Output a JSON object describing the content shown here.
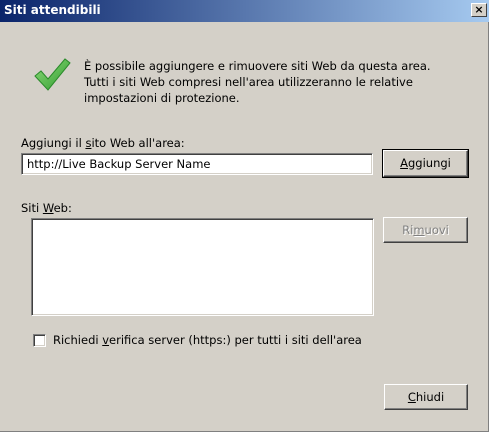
{
  "window": {
    "title": "Siti attendibili",
    "close_glyph": "×"
  },
  "intro": {
    "icon": "checkmark-icon",
    "text": "È possibile aggiungere e rimuovere siti Web da questa area.\nTutti i siti Web compresi nell'area utilizzeranno le relative\nimpostazioni di protezione."
  },
  "add_site": {
    "label_pre": "Aggiungi il ",
    "label_mnemonic": "s",
    "label_post": "ito Web all'area:",
    "value": "http://Live Backup Server Name",
    "button_mnemonic": "A",
    "button_rest": "ggiungi"
  },
  "sites": {
    "label_pre": "Siti ",
    "label_mnemonic": "W",
    "label_post": "eb:",
    "items": [],
    "remove_pre": "Ri",
    "remove_mnemonic": "m",
    "remove_post": "uovi"
  },
  "https_option": {
    "checked": false,
    "label_pre": "Richiedi ",
    "label_mnemonic": "v",
    "label_post": "erifica server (https:) per tutti i siti dell'area"
  },
  "footer": {
    "close_mnemonic": "C",
    "close_rest": "hiudi"
  },
  "colors": {
    "title_gradient_start": "#0a246a",
    "title_gradient_end": "#a6caf0",
    "face": "#d4d0c8",
    "check_green": "#3aa53a"
  }
}
